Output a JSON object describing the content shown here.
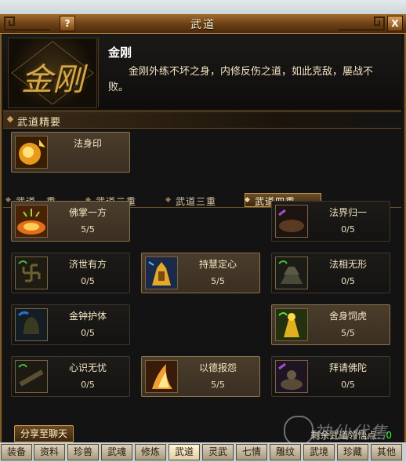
{
  "window": {
    "title": "武道"
  },
  "buttons": {
    "help": "?",
    "close": "X",
    "share": "分享至聊天"
  },
  "header": {
    "emblem_char": "金刚",
    "skill_name": "金刚",
    "description": "金刚外练不坏之身，内修反伤之道，如此克敌，屡战不败。"
  },
  "section": {
    "title": "武道精要"
  },
  "essence_skill": {
    "name": "法身印"
  },
  "tabs": [
    {
      "label": "武道一重"
    },
    {
      "label": "武道二重"
    },
    {
      "label": "武道三重"
    },
    {
      "label": "武道四重"
    }
  ],
  "active_tab": 3,
  "skills": [
    {
      "name": "佛掌一方",
      "level": "5/5"
    },
    {
      "name": "法界归一",
      "level": "0/5"
    },
    {
      "name": "济世有方",
      "level": "0/5"
    },
    {
      "name": "持慧定心",
      "level": "5/5"
    },
    {
      "name": "法相无形",
      "level": "0/5"
    },
    {
      "name": "金钟护体",
      "level": "0/5"
    },
    {
      "name": "舍身饲虎",
      "level": "5/5"
    },
    {
      "name": "心识无忧",
      "level": "0/5"
    },
    {
      "name": "以德报怨",
      "level": "5/5"
    },
    {
      "name": "拜请佛陀",
      "level": "0/5"
    }
  ],
  "points": {
    "label": "剩余武道领悟点：",
    "value": "0"
  },
  "watermark": {
    "text": "神仙代售"
  },
  "bottom_tabs": [
    {
      "label": "装备"
    },
    {
      "label": "资料"
    },
    {
      "label": "珍兽"
    },
    {
      "label": "武魂"
    },
    {
      "label": "修炼"
    },
    {
      "label": "武道"
    },
    {
      "label": "灵武"
    },
    {
      "label": "七情"
    },
    {
      "label": "雕纹"
    },
    {
      "label": "武境"
    },
    {
      "label": "珍藏"
    },
    {
      "label": "其他"
    }
  ],
  "colors": {
    "accent_gold": "#c49550",
    "points_green": "#33ff33"
  },
  "icons": {
    "essence": "golden-seal-icon",
    "skills": [
      "palm-icon",
      "realm-icon",
      "swastika-icon",
      "golden-statue-icon",
      "pagoda-icon",
      "bell-icon",
      "golden-figure-icon",
      "mind-icon",
      "flame-icon",
      "buddha-icon"
    ]
  }
}
